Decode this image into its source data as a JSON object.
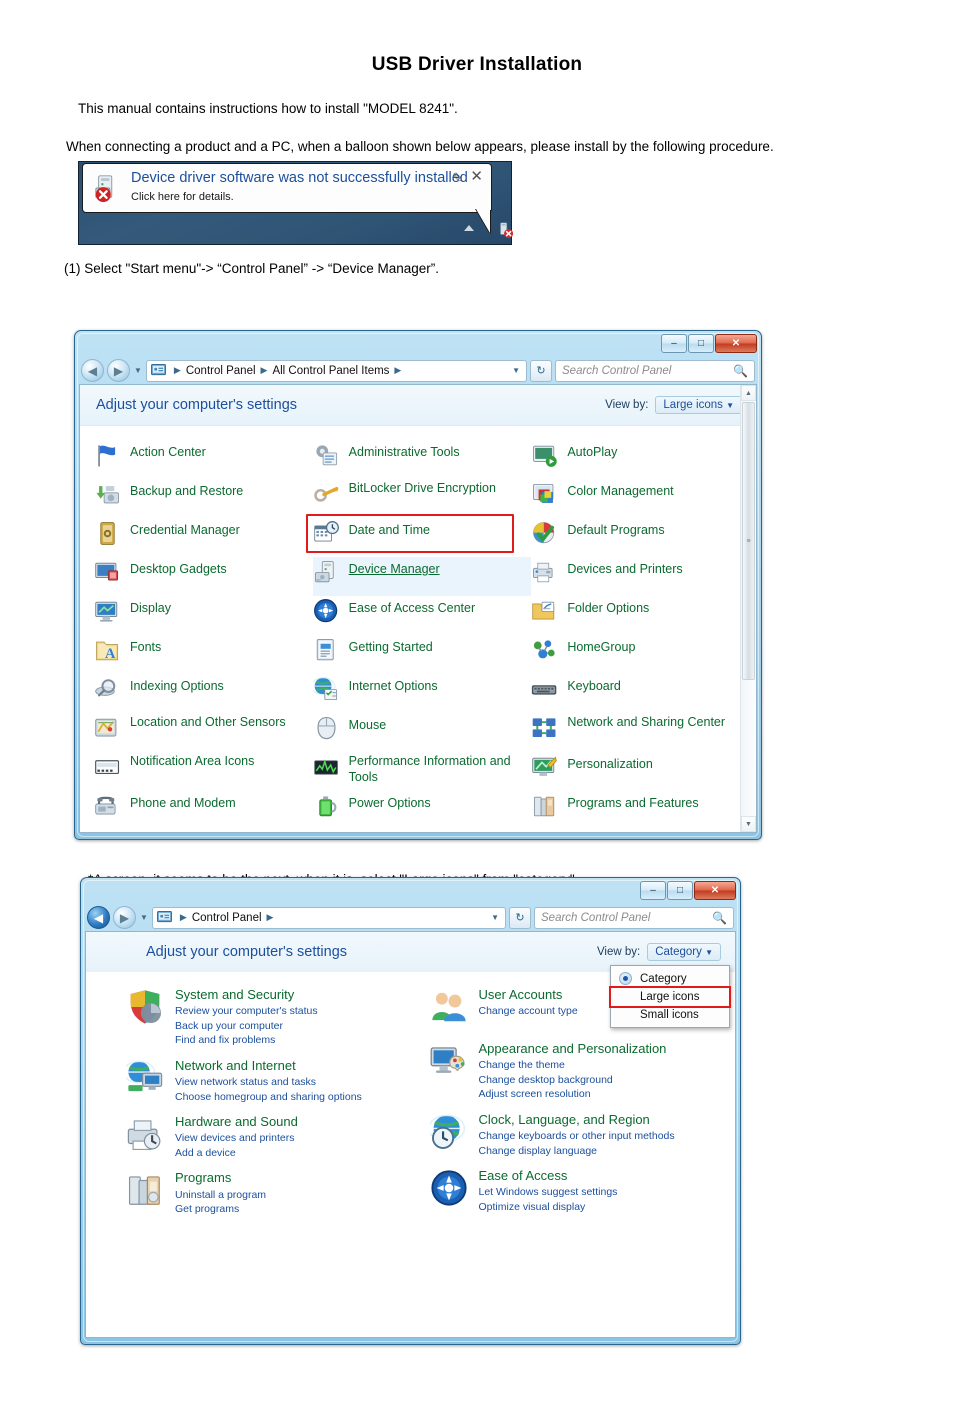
{
  "document": {
    "title": "USB Driver Installation",
    "intro": "This manual contains instructions how to install \"MODEL 8241\".",
    "intro2": "When connecting a product and a PC,  when a balloon shown below appears, please install by the following procedure.",
    "step1": "(1)  Select  \"Start menu\"-> “Control Panel” -> “Device Manager”.",
    "note": "*A screen, it seems to be the next, when it is, select \"Large icons\" from \"category\"."
  },
  "balloon": {
    "title": "Device driver software was not successfully installed",
    "subtitle": "Click here for details.",
    "pin_icon": "pin-icon",
    "close_icon": "close-icon",
    "tray_icon": "device-error-tray-icon"
  },
  "window_icons": {
    "title": "Control Panel",
    "minimize": "–",
    "maximize": "□",
    "close": "✕"
  },
  "cp_large": {
    "breadcrumb": [
      "Control Panel",
      "All Control Panel Items"
    ],
    "search_placeholder": "Search Control Panel",
    "header_title": "Adjust your computer's settings",
    "view_by_label": "View by:",
    "view_by_value": "Large icons",
    "selected_item": "Device Manager",
    "items": [
      {
        "label": "Action Center",
        "icon": "flag-icon"
      },
      {
        "label": "Administrative Tools",
        "icon": "gears-tools-icon"
      },
      {
        "label": "AutoPlay",
        "icon": "autoplay-icon"
      },
      {
        "label": "Backup and Restore",
        "icon": "backup-restore-icon"
      },
      {
        "label": "BitLocker Drive Encryption",
        "icon": "bitlocker-key-icon"
      },
      {
        "label": "Color Management",
        "icon": "color-management-icon"
      },
      {
        "label": "Credential Manager",
        "icon": "credential-vault-icon"
      },
      {
        "label": "Date and Time",
        "icon": "calendar-clock-icon"
      },
      {
        "label": "Default Programs",
        "icon": "default-programs-icon"
      },
      {
        "label": "Desktop Gadgets",
        "icon": "desktop-gadgets-icon"
      },
      {
        "label": "Device Manager",
        "icon": "device-manager-icon"
      },
      {
        "label": "Devices and Printers",
        "icon": "devices-printers-icon"
      },
      {
        "label": "Display",
        "icon": "display-monitor-icon"
      },
      {
        "label": "Ease of Access Center",
        "icon": "ease-of-access-icon"
      },
      {
        "label": "Folder Options",
        "icon": "folder-options-icon"
      },
      {
        "label": "Fonts",
        "icon": "fonts-folder-icon"
      },
      {
        "label": "Getting Started",
        "icon": "getting-started-icon"
      },
      {
        "label": "HomeGroup",
        "icon": "homegroup-icon"
      },
      {
        "label": "Indexing Options",
        "icon": "indexing-magnifier-icon"
      },
      {
        "label": "Internet Options",
        "icon": "internet-globe-icon"
      },
      {
        "label": "Keyboard",
        "icon": "keyboard-icon"
      },
      {
        "label": "Location and Other Sensors",
        "icon": "location-sensors-icon"
      },
      {
        "label": "Mouse",
        "icon": "mouse-icon"
      },
      {
        "label": "Network and Sharing Center",
        "icon": "network-sharing-icon"
      },
      {
        "label": "Notification Area Icons",
        "icon": "notification-area-icon"
      },
      {
        "label": "Performance Information and Tools",
        "icon": "performance-graph-icon"
      },
      {
        "label": "Personalization",
        "icon": "personalization-icon"
      },
      {
        "label": "Phone and Modem",
        "icon": "phone-modem-icon"
      },
      {
        "label": "Power Options",
        "icon": "power-battery-icon"
      },
      {
        "label": "Programs and Features",
        "icon": "programs-features-icon"
      }
    ]
  },
  "cp_category": {
    "breadcrumb": [
      "Control Panel"
    ],
    "search_placeholder": "Search Control Panel",
    "header_title": "Adjust your computer's settings",
    "view_by_label": "View by:",
    "view_by_value": "Category",
    "menu": {
      "items": [
        {
          "label": "Category",
          "selected": true
        },
        {
          "label": "Large icons",
          "selected": false,
          "highlighted": true
        },
        {
          "label": "Small icons",
          "selected": false
        }
      ]
    },
    "categories_left": [
      {
        "title": "System and Security",
        "icon": "shield-security-icon",
        "links": [
          "Review your computer's status",
          "Back up your computer",
          "Find and fix problems"
        ]
      },
      {
        "title": "Network and Internet",
        "icon": "network-globe-icon",
        "links": [
          "View network status and tasks",
          "Choose homegroup and sharing options"
        ]
      },
      {
        "title": "Hardware and Sound",
        "icon": "hardware-sound-icon",
        "links": [
          "View devices and printers",
          "Add a device"
        ]
      },
      {
        "title": "Programs",
        "icon": "programs-icon",
        "links": [
          "Uninstall a program",
          "Get programs"
        ]
      }
    ],
    "categories_right": [
      {
        "title": "User Accounts",
        "icon": "user-accounts-icon",
        "links": [
          "Change account type"
        ]
      },
      {
        "title": "Appearance and Personalization",
        "icon": "appearance-icon",
        "links": [
          "Change the theme",
          "Change desktop background",
          "Adjust screen resolution"
        ]
      },
      {
        "title": "Clock, Language, and Region",
        "icon": "clock-region-icon",
        "links": [
          "Change keyboards or other input methods",
          "Change display language"
        ]
      },
      {
        "title": "Ease of Access",
        "icon": "ease-of-access-icon",
        "links": [
          "Let Windows suggest settings",
          "Optimize visual display"
        ]
      }
    ]
  },
  "colors": {
    "accent_blue": "#1c4f9c",
    "link_green": "#0b6a2f",
    "highlight_red": "#e01b1b",
    "window_chrome": "#a9d6ef"
  }
}
